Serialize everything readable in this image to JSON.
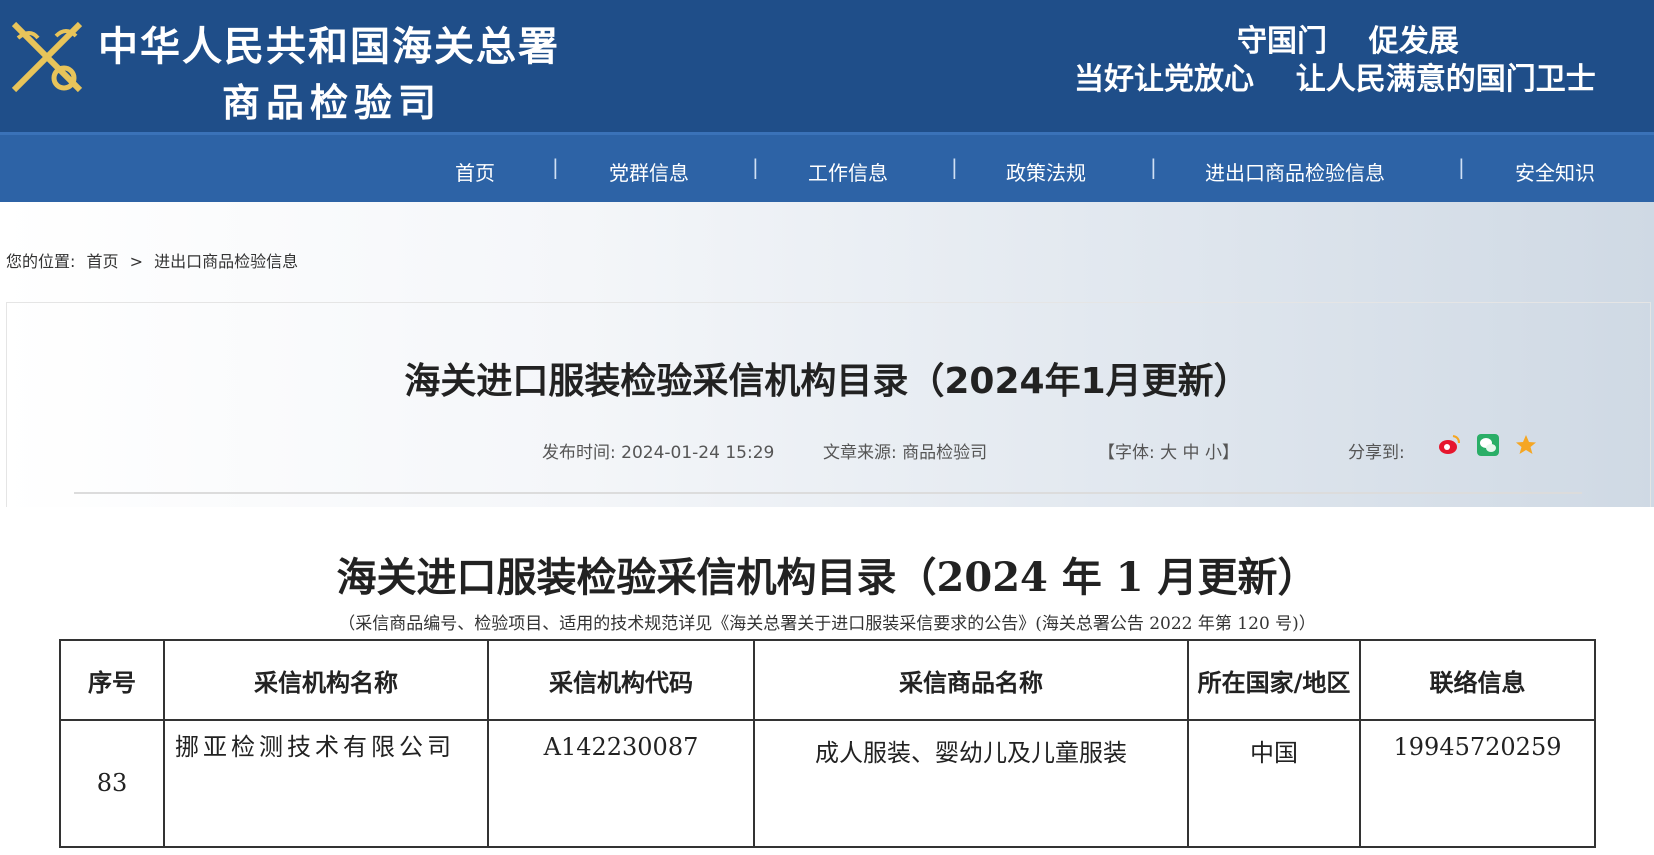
{
  "header": {
    "org_name": "中华人民共和国海关总署",
    "dept_name": "商品检验司",
    "slogan_line1": "守国门    促发展",
    "slogan_line2": "当好让党放心    让人民满意的国门卫士"
  },
  "nav": {
    "items": [
      "首页",
      "党群信息",
      "工作信息",
      "政策法规",
      "进出口商品检验信息",
      "安全知识"
    ],
    "separator": "|"
  },
  "breadcrumb": {
    "label": "您的位置:",
    "items": [
      "首页",
      "进出口商品检验信息"
    ],
    "separator": ">"
  },
  "article": {
    "title": "海关进口服装检验采信机构目录（2024年1月更新）",
    "published": "发布时间: 2024-01-24 15:29",
    "source": "文章来源: 商品检验司",
    "font_size_control": "【字体: 大 中 小】",
    "share_label": "分享到:",
    "share_icons": [
      "weibo-icon",
      "wechat-icon",
      "favorite-icon"
    ],
    "accent_colors": {
      "weibo": "#e6162d",
      "wechat": "#2aae67",
      "favorite": "#f5a623"
    }
  },
  "document": {
    "title": "海关进口服装检验采信机构目录（2024 年 1 月更新）",
    "note": "（采信商品编号、检验项目、适用的技术规范详见《海关总署关于进口服装采信要求的公告》(海关总署公告 2022 年第 120 号)）",
    "table": {
      "headers": [
        "序号",
        "采信机构名称",
        "采信机构代码",
        "采信商品名称",
        "所在国家/地区",
        "联络信息"
      ],
      "rows": [
        [
          "83",
          "挪亚检测技术有限公司",
          "A142230087",
          "成人服装、婴幼儿及儿童服装",
          "中国",
          "19945720259"
        ]
      ]
    }
  },
  "colors": {
    "header_bg": "#1f4e89",
    "nav_bg": "#2d63a6"
  }
}
